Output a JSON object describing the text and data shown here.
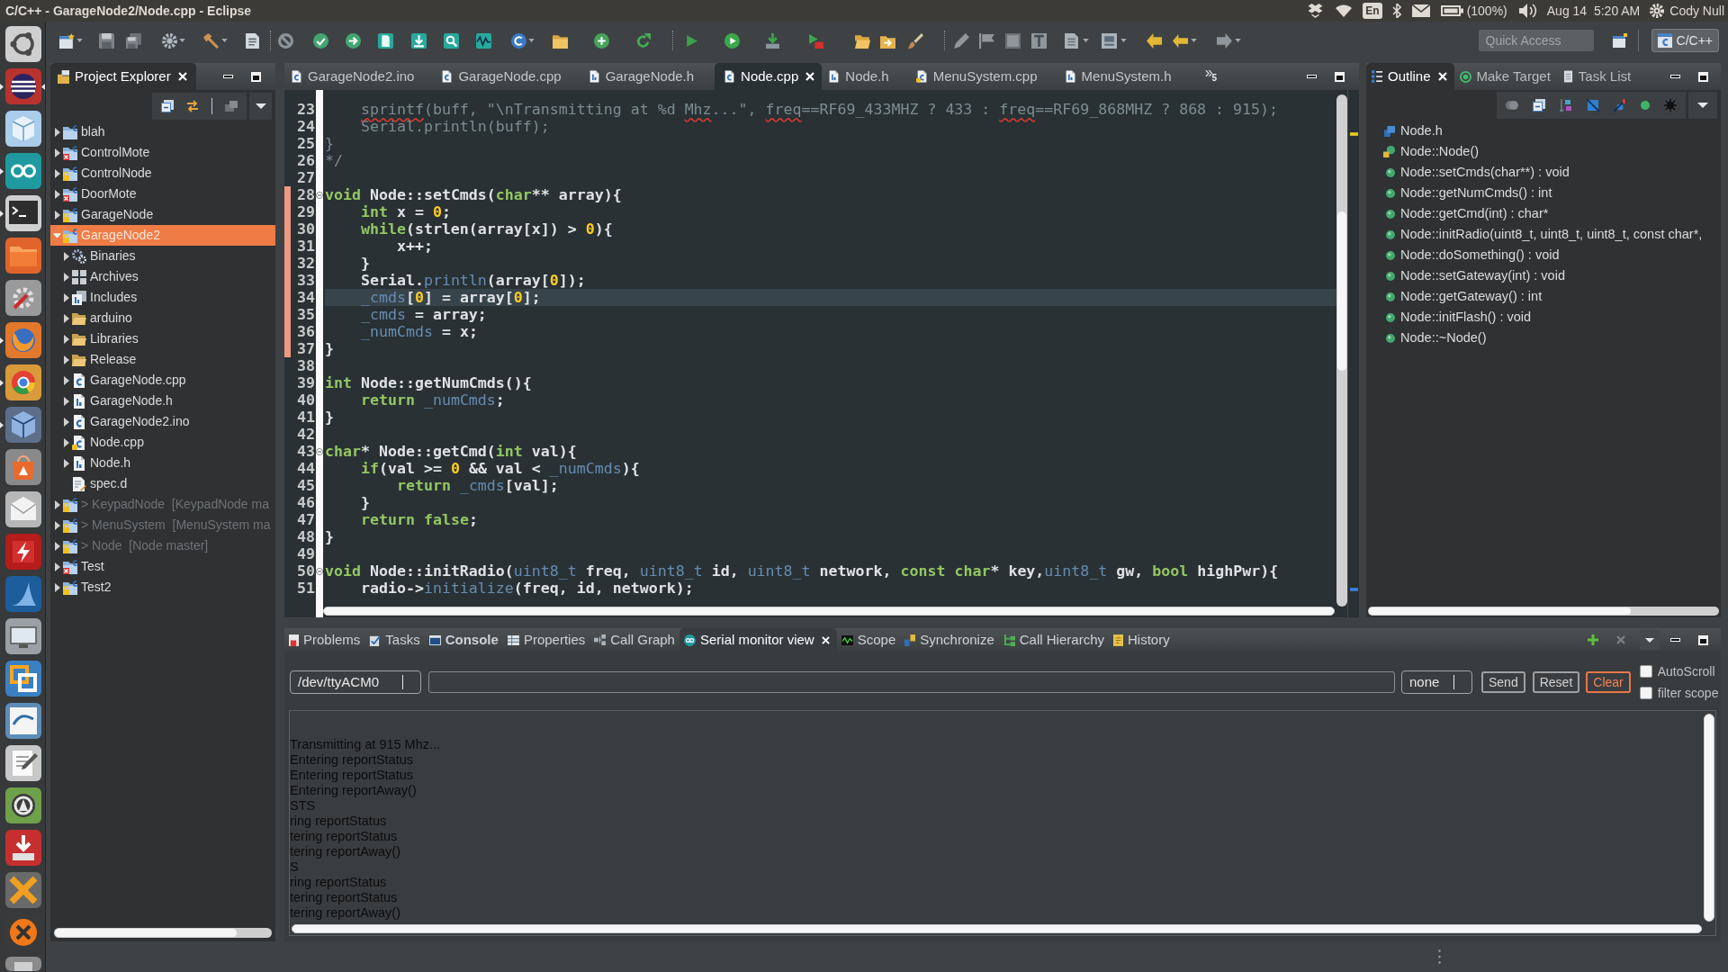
{
  "window": {
    "title": "C/C++ - GarageNode2/Node.cpp - Eclipse"
  },
  "top_panel": {
    "keyboard_layout": "En",
    "battery": "(100%)",
    "clock": "Aug 14  5:20 AM",
    "user": "Cody Null"
  },
  "toolbar": {
    "quick_access": {
      "placeholder": "Quick Access"
    },
    "perspectives": [
      {
        "label": "C/C++",
        "selected": true
      }
    ]
  },
  "project_explorer": {
    "title": "Project Explorer",
    "items": [
      {
        "label": "blah",
        "kind": "project",
        "expanded": false,
        "selected": false,
        "disabled": false
      },
      {
        "label": "ControlMote",
        "kind": "project-error",
        "expanded": false,
        "selected": false,
        "disabled": false
      },
      {
        "label": "ControlNode",
        "kind": "project-git",
        "expanded": false,
        "selected": false,
        "disabled": false
      },
      {
        "label": "DoorMote",
        "kind": "project-error",
        "expanded": false,
        "selected": false,
        "disabled": false
      },
      {
        "label": "GarageNode",
        "kind": "project-git",
        "expanded": false,
        "selected": false,
        "disabled": false
      },
      {
        "label": "GarageNode2",
        "kind": "project-git",
        "expanded": true,
        "selected": true,
        "disabled": false,
        "children": [
          {
            "label": "Binaries",
            "kind": "binaries",
            "expanded": false,
            "selected": false
          },
          {
            "label": "Archives",
            "kind": "archives",
            "expanded": false,
            "selected": false
          },
          {
            "label": "Includes",
            "kind": "includes",
            "expanded": false,
            "selected": false
          },
          {
            "label": "arduino",
            "kind": "folder",
            "expanded": false,
            "selected": false
          },
          {
            "label": "Libraries",
            "kind": "folder",
            "expanded": false,
            "selected": false
          },
          {
            "label": "Release",
            "kind": "folder",
            "expanded": false,
            "selected": false
          },
          {
            "label": "GarageNode.cpp",
            "kind": "source",
            "expanded": false,
            "selected": false
          },
          {
            "label": "GarageNode.h",
            "kind": "header",
            "expanded": false,
            "selected": false
          },
          {
            "label": "GarageNode2.ino",
            "kind": "source",
            "expanded": false,
            "selected": false
          },
          {
            "label": "Node.cpp",
            "kind": "source-locked",
            "expanded": false,
            "selected": false
          },
          {
            "label": "Node.h",
            "kind": "header",
            "expanded": false,
            "selected": false
          },
          {
            "label": "spec.d",
            "kind": "text",
            "selected": false
          }
        ]
      },
      {
        "label": "> KeypadNode  [KeypadNode ma",
        "kind": "project-git",
        "expanded": false,
        "selected": false,
        "disabled": true
      },
      {
        "label": "> MenuSystem  [MenuSystem ma",
        "kind": "project-git",
        "expanded": false,
        "selected": false,
        "disabled": true
      },
      {
        "label": "> Node  [Node master]",
        "kind": "project-git",
        "expanded": false,
        "selected": false,
        "disabled": true
      },
      {
        "label": "Test",
        "kind": "project-error",
        "expanded": false,
        "selected": false,
        "disabled": false
      },
      {
        "label": "Test2",
        "kind": "project-git",
        "expanded": false,
        "selected": false,
        "disabled": false
      }
    ]
  },
  "editor": {
    "tabs": [
      {
        "label": "GarageNode2.ino",
        "kind": "source",
        "selected": false
      },
      {
        "label": "GarageNode.cpp",
        "kind": "source",
        "selected": false
      },
      {
        "label": "GarageNode.h",
        "kind": "header",
        "selected": false
      },
      {
        "label": "Node.cpp",
        "kind": "source",
        "selected": true
      },
      {
        "label": "Node.h",
        "kind": "header",
        "selected": false
      },
      {
        "label": "MenuSystem.cpp",
        "kind": "source-locked",
        "selected": false
      },
      {
        "label": "MenuSystem.h",
        "kind": "header",
        "selected": false
      }
    ],
    "hidden_tab_count": "5",
    "lines": [
      {
        "number": "23",
        "changed": false,
        "current": false,
        "tokens": [
          {
            "kind": "typo",
            "text": "    sprintf"
          },
          {
            "kind": "comment",
            "text": "(buff, \"\\nTransmitting at %d "
          },
          {
            "kind": "typo",
            "text": "Mhz"
          },
          {
            "kind": "comment",
            "text": "...\", "
          },
          {
            "kind": "typo",
            "text": "freq"
          },
          {
            "kind": "comment",
            "text": "==RF69_433MHZ ? 433 : "
          },
          {
            "kind": "typo",
            "text": "freq"
          },
          {
            "kind": "comment",
            "text": "==RF69_868MHZ ? 868 : 915);"
          }
        ]
      },
      {
        "number": "24",
        "changed": false,
        "current": false,
        "tokens": [
          {
            "kind": "comment",
            "text": "    Serial.println(buff);"
          }
        ]
      },
      {
        "number": "25",
        "changed": false,
        "current": false,
        "tokens": [
          {
            "kind": "comment",
            "text": "}"
          }
        ]
      },
      {
        "number": "26",
        "changed": false,
        "current": false,
        "tokens": [
          {
            "kind": "comment",
            "text": "*/"
          }
        ]
      },
      {
        "number": "27",
        "changed": false,
        "current": false
      },
      {
        "number": "28",
        "changed": true,
        "current": false,
        "collapsed": false,
        "tokens": [
          {
            "kind": "keyword",
            "text": "void"
          },
          {
            "kind": "plain",
            "text": " Node::setCmds("
          },
          {
            "kind": "keyword",
            "text": "char"
          },
          {
            "kind": "plain",
            "text": "** array){"
          }
        ]
      },
      {
        "number": "29",
        "changed": true,
        "current": false,
        "tokens": [
          {
            "kind": "keyword",
            "text": "    int"
          },
          {
            "kind": "plain",
            "text": " x = "
          },
          {
            "kind": "number",
            "text": "0"
          },
          {
            "kind": "plain",
            "text": ";"
          }
        ]
      },
      {
        "number": "30",
        "changed": true,
        "current": false,
        "tokens": [
          {
            "kind": "keyword",
            "text": "    while"
          },
          {
            "kind": "plain",
            "text": "(strlen(array[x]) > "
          },
          {
            "kind": "number",
            "text": "0"
          },
          {
            "kind": "plain",
            "text": "){"
          }
        ]
      },
      {
        "number": "31",
        "changed": true,
        "current": false,
        "tokens": [
          {
            "kind": "plain",
            "text": "        x++;"
          }
        ]
      },
      {
        "number": "32",
        "changed": true,
        "current": false,
        "tokens": [
          {
            "kind": "plain",
            "text": "    }"
          }
        ]
      },
      {
        "number": "33",
        "changed": true,
        "current": false,
        "tokens": [
          {
            "kind": "plain",
            "text": "    Serial."
          },
          {
            "kind": "method",
            "text": "println"
          },
          {
            "kind": "plain",
            "text": "(array["
          },
          {
            "kind": "number",
            "text": "0"
          },
          {
            "kind": "plain",
            "text": "]);"
          }
        ]
      },
      {
        "number": "34",
        "changed": true,
        "current": true,
        "tokens": [
          {
            "kind": "field",
            "text": "    _cmds"
          },
          {
            "kind": "plain",
            "text": "["
          },
          {
            "kind": "number",
            "text": "0"
          },
          {
            "kind": "plain",
            "text": "] = array["
          },
          {
            "kind": "number",
            "text": "0"
          },
          {
            "kind": "plain",
            "text": "];"
          }
        ]
      },
      {
        "number": "35",
        "changed": true,
        "current": false,
        "tokens": [
          {
            "kind": "field",
            "text": "    _cmds"
          },
          {
            "kind": "plain",
            "text": " = array;"
          }
        ]
      },
      {
        "number": "36",
        "changed": true,
        "current": false,
        "tokens": [
          {
            "kind": "field",
            "text": "    _numCmds"
          },
          {
            "kind": "plain",
            "text": " = x;"
          }
        ]
      },
      {
        "number": "37",
        "changed": true,
        "current": false,
        "tokens": [
          {
            "kind": "plain",
            "text": "}"
          }
        ]
      },
      {
        "number": "38",
        "changed": false,
        "current": false
      },
      {
        "number": "39",
        "changed": false,
        "current": false,
        "tokens": [
          {
            "kind": "keyword",
            "text": "int"
          },
          {
            "kind": "plain",
            "text": " Node::getNumCmds(){"
          }
        ]
      },
      {
        "number": "40",
        "changed": false,
        "current": false,
        "tokens": [
          {
            "kind": "keyword",
            "text": "    return"
          },
          {
            "kind": "field",
            "text": " _numCmds"
          },
          {
            "kind": "plain",
            "text": ";"
          }
        ]
      },
      {
        "number": "41",
        "changed": false,
        "current": false,
        "tokens": [
          {
            "kind": "plain",
            "text": "}"
          }
        ]
      },
      {
        "number": "42",
        "changed": false,
        "current": false
      },
      {
        "number": "43",
        "changed": false,
        "current": false,
        "collapsed": false,
        "tokens": [
          {
            "kind": "keyword",
            "text": "char"
          },
          {
            "kind": "plain",
            "text": "* Node::getCmd("
          },
          {
            "kind": "keyword",
            "text": "int"
          },
          {
            "kind": "plain",
            "text": " val){"
          }
        ]
      },
      {
        "number": "44",
        "changed": false,
        "current": false,
        "tokens": [
          {
            "kind": "keyword",
            "text": "    if"
          },
          {
            "kind": "plain",
            "text": "(val >= "
          },
          {
            "kind": "number",
            "text": "0"
          },
          {
            "kind": "plain",
            "text": " && val < "
          },
          {
            "kind": "field",
            "text": "_numCmds"
          },
          {
            "kind": "plain",
            "text": "){"
          }
        ]
      },
      {
        "number": "45",
        "changed": false,
        "current": false,
        "tokens": [
          {
            "kind": "keyword",
            "text": "        return"
          },
          {
            "kind": "field",
            "text": " _cmds"
          },
          {
            "kind": "plain",
            "text": "[val];"
          }
        ]
      },
      {
        "number": "46",
        "changed": false,
        "current": false,
        "tokens": [
          {
            "kind": "plain",
            "text": "    }"
          }
        ]
      },
      {
        "number": "47",
        "changed": false,
        "current": false,
        "tokens": [
          {
            "kind": "keyword",
            "text": "    return"
          },
          {
            "kind": "keyword",
            "text": " false"
          },
          {
            "kind": "plain",
            "text": ";"
          }
        ]
      },
      {
        "number": "48",
        "changed": false,
        "current": false,
        "tokens": [
          {
            "kind": "plain",
            "text": "}"
          }
        ]
      },
      {
        "number": "49",
        "changed": false,
        "current": false
      },
      {
        "number": "50",
        "changed": false,
        "current": false,
        "collapsed": false,
        "tokens": [
          {
            "kind": "keyword",
            "text": "void"
          },
          {
            "kind": "plain",
            "text": " Node::initRadio("
          },
          {
            "kind": "type",
            "text": "uint8_t"
          },
          {
            "kind": "plain",
            "text": " freq, "
          },
          {
            "kind": "type",
            "text": "uint8_t"
          },
          {
            "kind": "plain",
            "text": " id, "
          },
          {
            "kind": "type",
            "text": "uint8_t"
          },
          {
            "kind": "plain",
            "text": " network, "
          },
          {
            "kind": "keyword",
            "text": "const"
          },
          {
            "kind": "keyword",
            "text": " char"
          },
          {
            "kind": "plain",
            "text": "* key,"
          },
          {
            "kind": "type",
            "text": "uint8_t"
          },
          {
            "kind": "plain",
            "text": " gw, "
          },
          {
            "kind": "keyword",
            "text": "bool"
          },
          {
            "kind": "plain",
            "text": " highPwr){"
          }
        ]
      },
      {
        "number": "51",
        "changed": false,
        "current": false,
        "tokens": [
          {
            "kind": "plain",
            "text": "    radio->"
          },
          {
            "kind": "method",
            "text": "initialize"
          },
          {
            "kind": "plain",
            "text": "(freq, id, network);"
          }
        ]
      }
    ]
  },
  "outline": {
    "tabs": [
      {
        "label": "Outline",
        "kind": "outline",
        "selected": true
      },
      {
        "label": "Make Target",
        "kind": "target",
        "selected": false
      },
      {
        "label": "Task List",
        "kind": "tasks",
        "selected": false
      }
    ],
    "items": [
      {
        "label": "Node.h",
        "kind": "include",
        "selected": false
      },
      {
        "label": "Node::Node()",
        "kind": "constructor",
        "selected": false
      },
      {
        "label": "Node::setCmds(char**) : void",
        "kind": "method",
        "selected": false
      },
      {
        "label": "Node::getNumCmds() : int",
        "kind": "method",
        "selected": false
      },
      {
        "label": "Node::getCmd(int) : char*",
        "kind": "method",
        "selected": false
      },
      {
        "label": "Node::initRadio(uint8_t, uint8_t, uint8_t, const char*,",
        "kind": "method",
        "selected": false
      },
      {
        "label": "Node::doSomething() : void",
        "kind": "method",
        "selected": false
      },
      {
        "label": "Node::setGateway(int) : void",
        "kind": "method",
        "selected": false
      },
      {
        "label": "Node::getGateway() : int",
        "kind": "method",
        "selected": false
      },
      {
        "label": "Node::initFlash() : void",
        "kind": "method",
        "selected": false
      },
      {
        "label": "Node::~Node()",
        "kind": "method",
        "selected": false
      }
    ]
  },
  "bottom_panel": {
    "tabs": [
      {
        "label": "Problems",
        "kind": "problems",
        "selected": false,
        "updated": false
      },
      {
        "label": "Tasks",
        "kind": "tasks",
        "selected": false,
        "updated": false
      },
      {
        "label": "Console",
        "kind": "console",
        "selected": false,
        "updated": true
      },
      {
        "label": "Properties",
        "kind": "properties",
        "selected": false,
        "updated": false
      },
      {
        "label": "Call Graph",
        "kind": "call-graph",
        "selected": false,
        "updated": false
      },
      {
        "label": "Serial monitor view",
        "kind": "serial",
        "selected": true,
        "updated": false
      },
      {
        "label": "Scope",
        "kind": "scope",
        "selected": false,
        "updated": false
      },
      {
        "label": "Synchronize",
        "kind": "synchronize",
        "selected": false,
        "updated": false
      },
      {
        "label": "Call Hierarchy",
        "kind": "hierarchy",
        "selected": false,
        "updated": false
      },
      {
        "label": "History",
        "kind": "history",
        "selected": false,
        "updated": false
      }
    ],
    "serial_monitor": {
      "port": "/dev/ttyACM0",
      "line_ending": "none",
      "buttons": [
        {
          "label": "Send",
          "focused": false
        },
        {
          "label": "Reset",
          "focused": false
        },
        {
          "label": "Clear",
          "focused": true
        }
      ],
      "options": [
        {
          "label": "AutoScroll",
          "checked": false
        },
        {
          "label": "filter scope",
          "checked": false
        }
      ],
      "output": [
        "Transmitting at 915 Mhz...",
        "Entering reportStatus",
        "Entering reportStatus",
        "Entering reportAway()",
        "STS",
        "ring reportStatus",
        "tering reportStatus",
        "tering reportAway()",
        "S",
        "ring reportStatus",
        "tering reportStatus",
        "tering reportAway()"
      ]
    }
  }
}
